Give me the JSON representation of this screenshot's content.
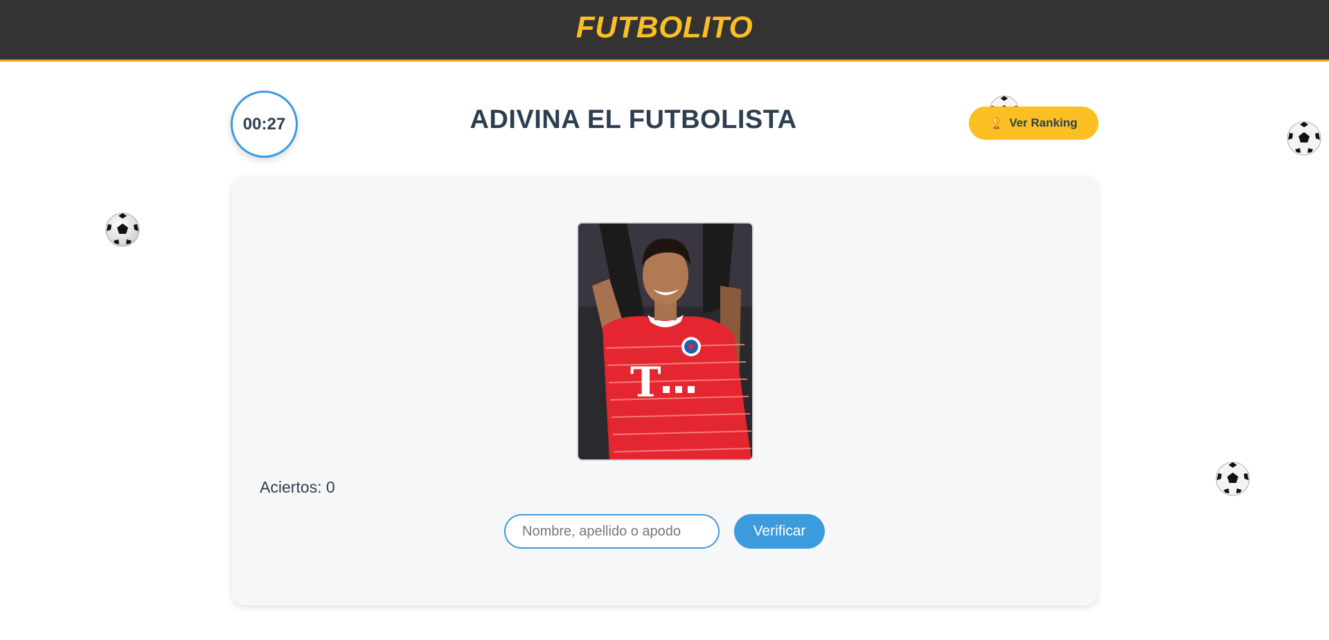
{
  "header": {
    "brand": "FUTBOLITO"
  },
  "game": {
    "timer": "00:27",
    "title": "ADIVINA EL FUTBOLISTA",
    "ranking_button": {
      "icon": "trophy-icon",
      "label": "Ver Ranking"
    },
    "score": "Aciertos: 0",
    "guess_input": {
      "placeholder": "Nombre, apellido o apodo",
      "value": ""
    },
    "verify_label": "Verificar",
    "photo": {
      "icon": "player-photo",
      "kit_color": "#e3262f",
      "sponsor_text": "T··"
    }
  },
  "decorations": {
    "icon": "soccer-ball-icon",
    "count": 5
  },
  "colors": {
    "accent": "#3b9bdc",
    "brand": "#fbbf24",
    "header_bg": "#333333",
    "text": "#2c3e50",
    "card_bg": "#f6f7f9"
  }
}
